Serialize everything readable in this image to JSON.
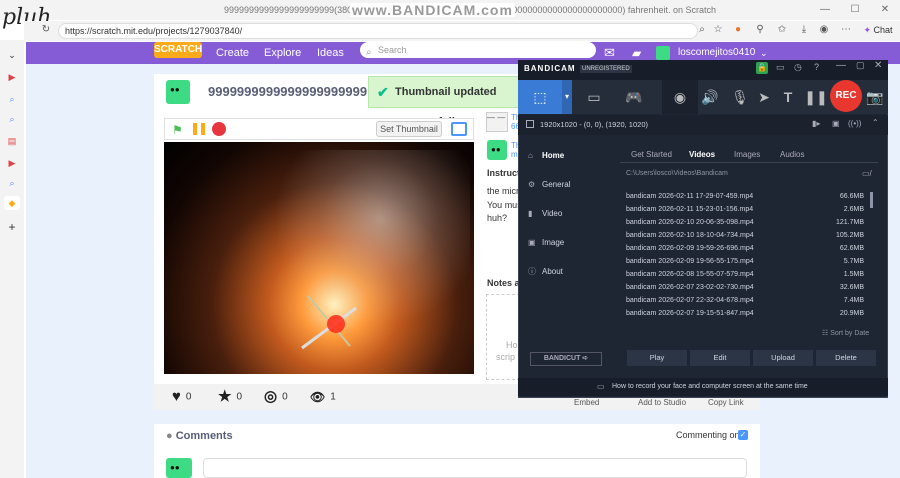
{
  "handwriting": "pluh",
  "window_title": "9999999999999999999999(380000000000000000000000000000000000000000000000000000000) fahrenheit. on Scratch",
  "watermark": "www.BANDICAM.com",
  "browser": {
    "url": "https://scratch.mit.edu/projects/1279037840/",
    "chat_label": "Chat"
  },
  "scratch": {
    "logo": "SCRATCH",
    "nav": [
      "Create",
      "Explore",
      "Ideas"
    ],
    "search_placeholder": "Search",
    "username": "loscomejitos0410",
    "project_title": "9999999999999999999999",
    "toast": "Thumbnail updated successfully",
    "set_thumbnail": "Set Thumbnail",
    "instructions_label": "Instruct",
    "instructions_lines": [
      "the micro",
      "You mus",
      "huh?"
    ],
    "notes_label": "Notes a",
    "notes_placeholder_lines": [
      "Ho",
      "scrip"
    ],
    "remix_lines": [
      "Th",
      "66",
      "Th",
      "m"
    ],
    "stats": [
      {
        "icon": "heart",
        "glyph": "♥",
        "count": "0"
      },
      {
        "icon": "star",
        "glyph": "★",
        "count": "0"
      },
      {
        "icon": "remix",
        "glyph": "◎",
        "count": "0"
      },
      {
        "icon": "view",
        "glyph": "👁",
        "count": "1"
      }
    ],
    "stats_links": [
      "Embed",
      "Add to Studio",
      "Copy Link"
    ],
    "comments_title": "Comments",
    "commenting_on": "Commenting on"
  },
  "bandicam": {
    "logo": "BANDICAM",
    "unregistered": "UNREGISTERED",
    "rec": "REC",
    "resolution": "1920x1020 - (0, 0), (1920, 1020)",
    "nav": [
      "Home",
      "General",
      "Video",
      "Image",
      "About"
    ],
    "tabs": [
      "Get Started",
      "Videos",
      "Images",
      "Audios"
    ],
    "path": "C:\\Users\\losco\\Videos\\Bandicam",
    "files": [
      {
        "name": "bandicam 2026-02-11 17-29-07-459.mp4",
        "size": "66.6MB"
      },
      {
        "name": "bandicam 2026-02-11 15-23-01-156.mp4",
        "size": "2.6MB"
      },
      {
        "name": "bandicam 2026-02-10 20-06-35-098.mp4",
        "size": "121.7MB"
      },
      {
        "name": "bandicam 2026-02-10 18-10-04-734.mp4",
        "size": "105.2MB"
      },
      {
        "name": "bandicam 2026-02-09 19-59-26-696.mp4",
        "size": "62.6MB"
      },
      {
        "name": "bandicam 2026-02-09 19-56-55-175.mp4",
        "size": "5.7MB"
      },
      {
        "name": "bandicam 2026-02-08 15-55-07-579.mp4",
        "size": "1.5MB"
      },
      {
        "name": "bandicam 2026-02-07 23-02-02-730.mp4",
        "size": "32.6MB"
      },
      {
        "name": "bandicam 2026-02-07 22-32-04-678.mp4",
        "size": "7.4MB"
      },
      {
        "name": "bandicam 2026-02-07 19-15-51-847.mp4",
        "size": "20.9MB"
      }
    ],
    "sort_by": "Sort by Date",
    "bandicut": "BANDICUT ➪",
    "buttons": [
      "Play",
      "Edit",
      "Upload",
      "Delete"
    ],
    "footer": "How to record your face and computer screen at the same time"
  }
}
